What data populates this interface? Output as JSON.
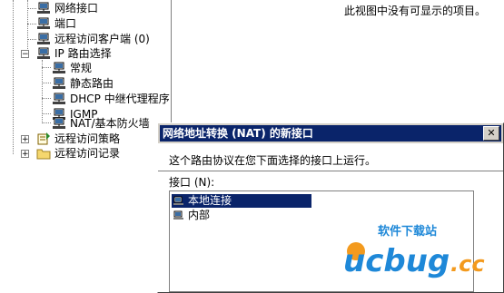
{
  "tree": {
    "items": [
      {
        "label": "网络接口"
      },
      {
        "label": "端口"
      },
      {
        "label": "远程访问客户端 (0)"
      },
      {
        "label": "IP 路由选择"
      },
      {
        "label": "常规"
      },
      {
        "label": "静态路由"
      },
      {
        "label": "DHCP 中继代理程序"
      },
      {
        "label": "IGMP"
      },
      {
        "label": "NAT/基本防火墙"
      },
      {
        "label": "远程访问策略"
      },
      {
        "label": "远程访问记录"
      }
    ]
  },
  "content": {
    "empty_message": "此视图中没有可显示的项目。"
  },
  "dialog": {
    "title": "网络地址转换 (NAT) 的新接口",
    "close_glyph": "✕",
    "instruction": "这个路由协议在您下面选择的接口上运行。",
    "interface_label": "接口 (N):",
    "interfaces": [
      {
        "label": "本地连接",
        "selected": true
      },
      {
        "label": "内部",
        "selected": false
      }
    ]
  },
  "watermark": {
    "brand": "ucbug",
    "suffix": ".cc",
    "tagline": "软件下载站"
  },
  "colors": {
    "titlebar": "#0a246a",
    "selection": "#0a246a",
    "watermark_blue": "#1e88d8",
    "watermark_orange": "#f39a1e"
  }
}
